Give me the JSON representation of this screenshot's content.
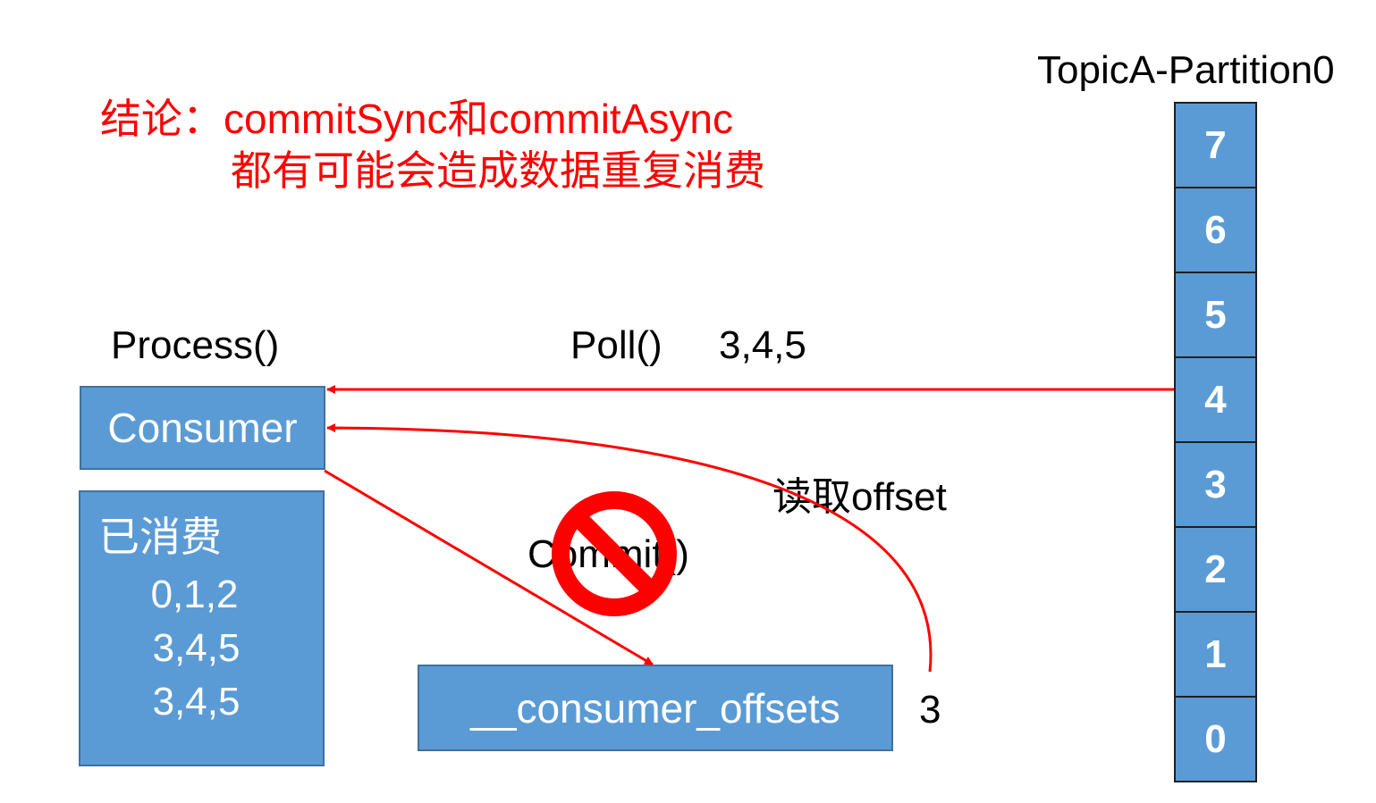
{
  "conclusion": {
    "line1": "结论：commitSync和commitAsync",
    "line2": "都有可能会造成数据重复消费"
  },
  "partition": {
    "title": "TopicA-Partition0",
    "cells": [
      "7",
      "6",
      "5",
      "4",
      "3",
      "2",
      "1",
      "0"
    ]
  },
  "consumer": {
    "process_label": "Process()",
    "box_label": "Consumer"
  },
  "consumed": {
    "title": "已消费",
    "rows": [
      "0,1,2",
      "3,4,5",
      "3,4,5"
    ]
  },
  "poll": {
    "label": "Poll()",
    "values": "3,4,5"
  },
  "read_offset": {
    "label": "读取offset"
  },
  "commit": {
    "label": "Commit()"
  },
  "offsets_store": {
    "label": "__consumer_offsets",
    "value": "3"
  },
  "colors": {
    "box_fill": "#5b9bd5",
    "arrow": "#ff0000",
    "conclusion_text": "#ff0000"
  },
  "icons": {
    "forbidden": "prohibited-icon"
  }
}
